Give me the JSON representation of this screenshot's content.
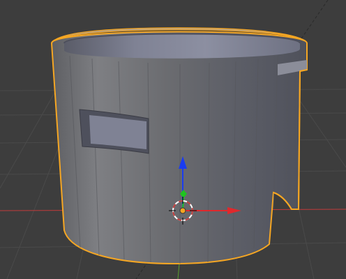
{
  "viewport": {
    "background_color": "#3d3d3d",
    "grid_color": "#4a4a4a",
    "x_axis_color": "#c23b3b",
    "y_axis_color": "#5aa02c"
  },
  "object": {
    "name": "cylinder-cup",
    "selected": true,
    "outline_color": "#f5a623",
    "body_color": "#6f6f74",
    "inner_color": "#7a7d8e"
  },
  "gizmo": {
    "x_color": "#e0282c",
    "y_color": "#1fc41f",
    "z_color": "#1a3cf0",
    "cursor_icon": "3d-cursor-icon"
  }
}
